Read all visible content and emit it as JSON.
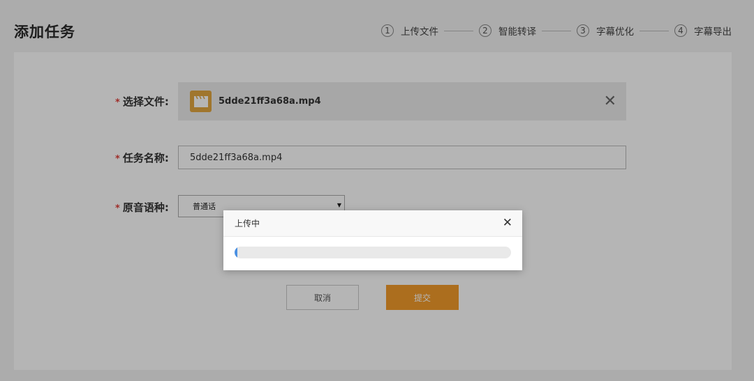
{
  "header": {
    "title": "添加任务"
  },
  "steps": [
    {
      "num": "1",
      "label": "上传文件"
    },
    {
      "num": "2",
      "label": "智能转译"
    },
    {
      "num": "3",
      "label": "字幕优化"
    },
    {
      "num": "4",
      "label": "字幕导出"
    }
  ],
  "form": {
    "required_mark": "*",
    "file": {
      "label": "选择文件:",
      "name": "5dde21ff3a68a.mp4",
      "icon": "video-file-icon",
      "remove_icon": "close-icon"
    },
    "task_name": {
      "label": "任务名称:",
      "value": "5dde21ff3a68a.mp4"
    },
    "language": {
      "label": "原音语种:",
      "selected": "普通话"
    },
    "cancel_label": "取消",
    "submit_label": "提交"
  },
  "modal": {
    "title": "上传中",
    "progress": 0.01
  },
  "colors": {
    "accent": "#f29b2b",
    "file_icon": "#e2a640",
    "required": "#e0403a"
  }
}
